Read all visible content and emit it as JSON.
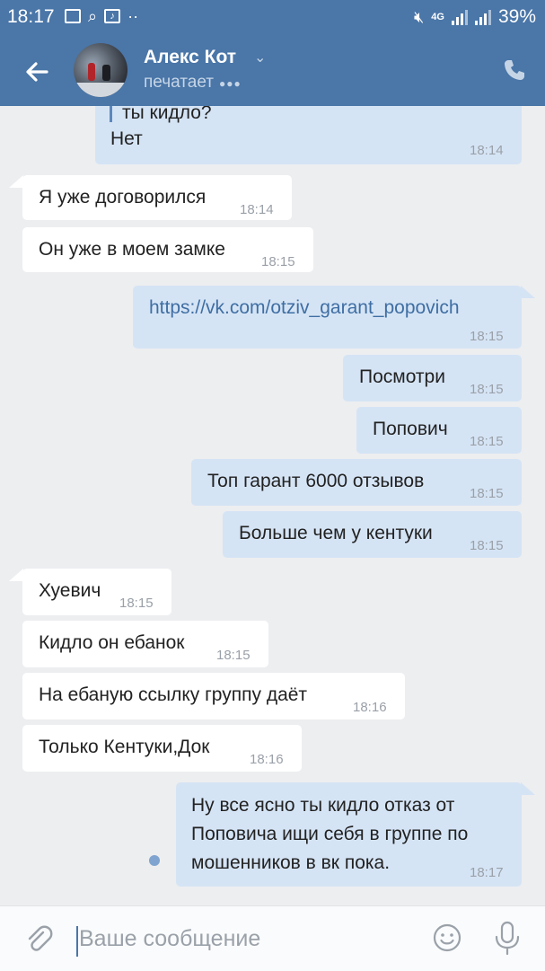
{
  "status_bar": {
    "time": "18:17",
    "network": "4G",
    "battery": "39%"
  },
  "header": {
    "name": "Алекс Кот",
    "status": "печатает",
    "typing_dots": "●●●",
    "chevron": "⌄"
  },
  "messages": [
    {
      "side": "out",
      "quote": "ты кидло?",
      "text": "Нет",
      "time": "18:14"
    },
    {
      "side": "in",
      "text": "Я уже договорился",
      "time": "18:14"
    },
    {
      "side": "in",
      "text": "Он уже в моем замке",
      "time": "18:15"
    },
    {
      "side": "out",
      "text": "https://vk.com/otziv_garant_popovich",
      "time": "18:15",
      "is_link": true
    },
    {
      "side": "out",
      "text": "Посмотри",
      "time": "18:15"
    },
    {
      "side": "out",
      "text": "Попович",
      "time": "18:15"
    },
    {
      "side": "out",
      "text": "Топ гарант 6000 отзывов",
      "time": "18:15"
    },
    {
      "side": "out",
      "text": "Больше чем у кентуки",
      "time": "18:15"
    },
    {
      "side": "in",
      "text": "Хуевич",
      "time": "18:15"
    },
    {
      "side": "in",
      "text": "Кидло он ебанок",
      "time": "18:15"
    },
    {
      "side": "in",
      "text": "На ебаную ссылку группу даёт",
      "time": "18:16"
    },
    {
      "side": "in",
      "text": "Только Кентуки,Док",
      "time": "18:16"
    },
    {
      "side": "out",
      "lines": [
        "Ну все ясно ты кидло отказ от",
        "Поповича ищи себя в группе по",
        "мошенников в вк пока."
      ],
      "time": "18:17"
    }
  ],
  "composer": {
    "placeholder": "Ваше сообщение"
  },
  "colors": {
    "header": "#4a76a8",
    "incoming": "#ffffff",
    "outgoing": "#d5e4f5",
    "background": "#edeef0"
  },
  "icons": [
    "back-arrow-icon",
    "phone-icon",
    "attach-icon",
    "smile-icon",
    "microphone-icon"
  ]
}
